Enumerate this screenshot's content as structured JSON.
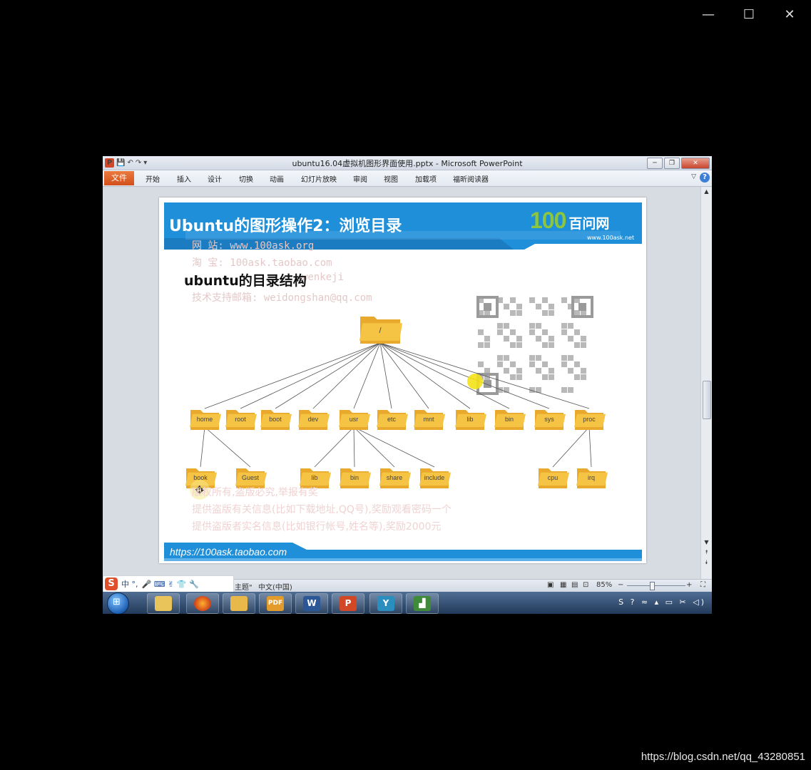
{
  "window_controls": {
    "minimize": "—",
    "maximize": "☐",
    "close": "✕"
  },
  "watermark": "https://blog.csdn.net/qq_43280851",
  "app": {
    "title": "ubuntu16.04虚拟机图形界面使用.pptx - Microsoft PowerPoint",
    "qat": {
      "save": "💾",
      "undo": "↶",
      "redo": "↷",
      "customize": "▾"
    },
    "title_controls": {
      "minimize": "─",
      "restore": "❐",
      "close": "✕"
    },
    "ribbon": {
      "file": "文件",
      "tabs": [
        "开始",
        "插入",
        "设计",
        "切换",
        "动画",
        "幻灯片放映",
        "审阅",
        "视图",
        "加载项",
        "福昕阅读器"
      ],
      "help": "?",
      "minimize_caret": "▽"
    }
  },
  "slide": {
    "title": "Ubuntu的图形操作2：浏览目录",
    "brand_number": "100",
    "brand_name": "百问网",
    "brand_url": "www.100ask.net",
    "subtitle": "ubuntu的目录结构",
    "watermark_lines": [
      "网        站: www.100ask.org",
      "淘        宝: 100ask.taobao.com",
      "wenkeji",
      "技术支持邮箱: weidongshan@qq.com"
    ],
    "watermark_bottom": [
      "版权所有,盗版必究,举报有奖",
      "提供盗版有关信息(比如下载地址,QQ号),奖励观看密码一个",
      "提供盗版者实名信息(比如银行帐号,姓名等),奖励2000元"
    ],
    "tree": {
      "root": "/",
      "level1": [
        "home",
        "root",
        "boot",
        "dev",
        "usr",
        "etc",
        "mnt",
        "lib",
        "bin",
        "sys",
        "proc"
      ],
      "home_children": [
        "book",
        "Guest"
      ],
      "usr_children": [
        "lib",
        "bin",
        "share",
        "include"
      ],
      "proc_children": [
        "cpu",
        "irq"
      ]
    },
    "footer_link": "https://100ask.taobao.com"
  },
  "statusbar": {
    "theme": "\"Office 主题\"",
    "language": "中文(中国)",
    "zoom": "85%",
    "zoom_out": "−",
    "zoom_in": "+"
  },
  "ime": {
    "logo": "S",
    "mode": "中 °,",
    "icons": "🎤 ⌨ ✌ 👕 🔧"
  },
  "taskbar": {
    "start": "⊞",
    "apps": [
      "Explorer",
      "Firefox",
      "Utility",
      "PDF",
      "W",
      "P",
      "Y",
      "Chart"
    ],
    "tray": "S ? ≈ ▴ ▭ ✂ ◁)"
  },
  "colors": {
    "banner_blue": "#1e8fd8",
    "accent_green": "#8cc63f",
    "folder_yellow": "#f6c445",
    "office_orange": "#d24726"
  }
}
